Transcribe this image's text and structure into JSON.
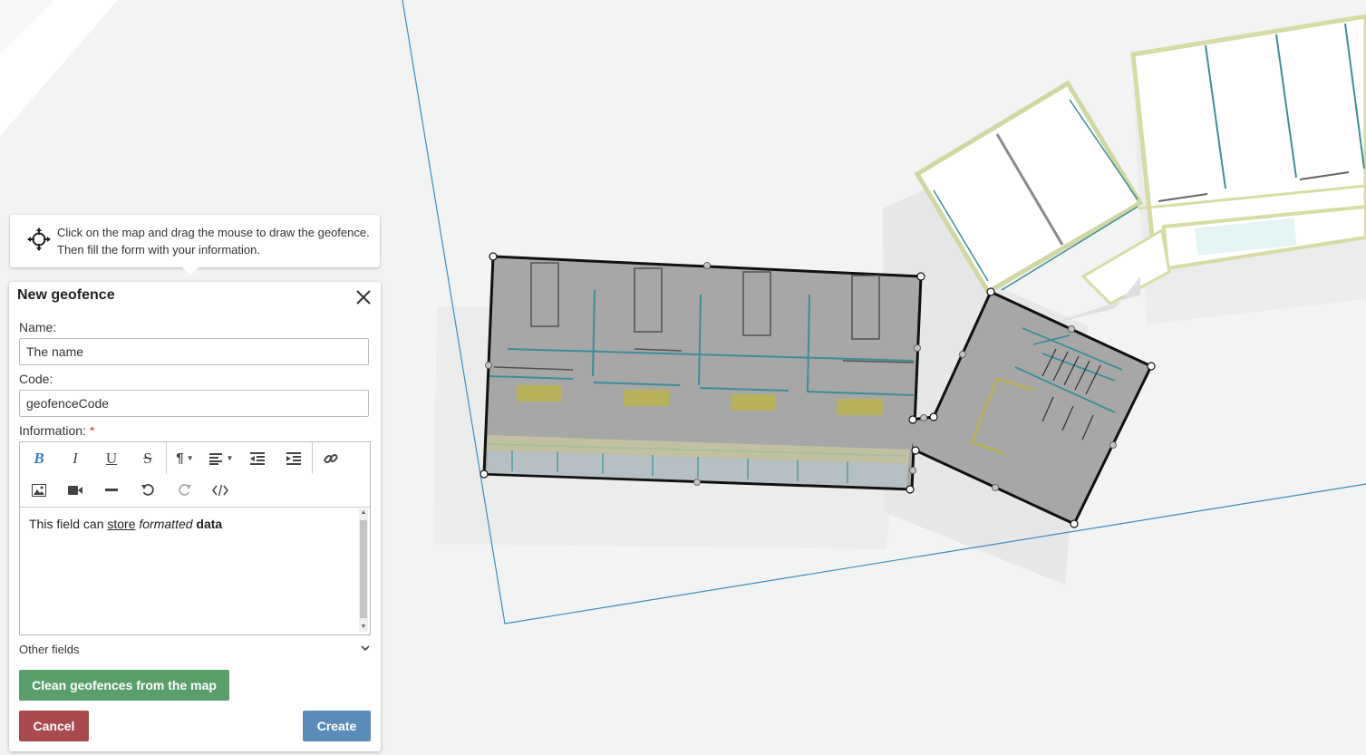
{
  "hint": {
    "line1": "Click on the map and drag the mouse to draw the geofence.",
    "line2": "Then fill the form with your information.",
    "icon": "crosshair-move-icon"
  },
  "form": {
    "title": "New geofence",
    "close_icon": "close-icon",
    "name_label": "Name:",
    "name_value": "The name",
    "code_label": "Code:",
    "code_value": "geofenceCode",
    "info_label": "Information:",
    "info_required_mark": "*",
    "toolbar": {
      "bold": "B",
      "italic": "I",
      "underline": "U",
      "strike": "S",
      "paragraph": "¶",
      "icons": [
        "bold-icon",
        "italic-icon",
        "underline-icon",
        "strikethrough-icon",
        "paragraph-icon",
        "align-icon",
        "outdent-icon",
        "indent-icon",
        "link-icon",
        "image-icon",
        "video-icon",
        "horizontal-rule-icon",
        "undo-icon",
        "redo-icon",
        "code-view-icon"
      ]
    },
    "content": {
      "plain": "This field can ",
      "underlined": "store",
      "space1": " ",
      "italic": "formatted",
      "space2": " ",
      "bold": "data"
    },
    "other_fields": "Other fields",
    "clean_button": "Clean geofences from the map",
    "cancel_button": "Cancel",
    "create_button": "Create"
  },
  "colors": {
    "clean": "#5a9e6a",
    "cancel": "#a94a4d",
    "create": "#5a8bb9",
    "geofence_fill": "#a7a7a7",
    "wall_teal": "#3b8e97"
  }
}
